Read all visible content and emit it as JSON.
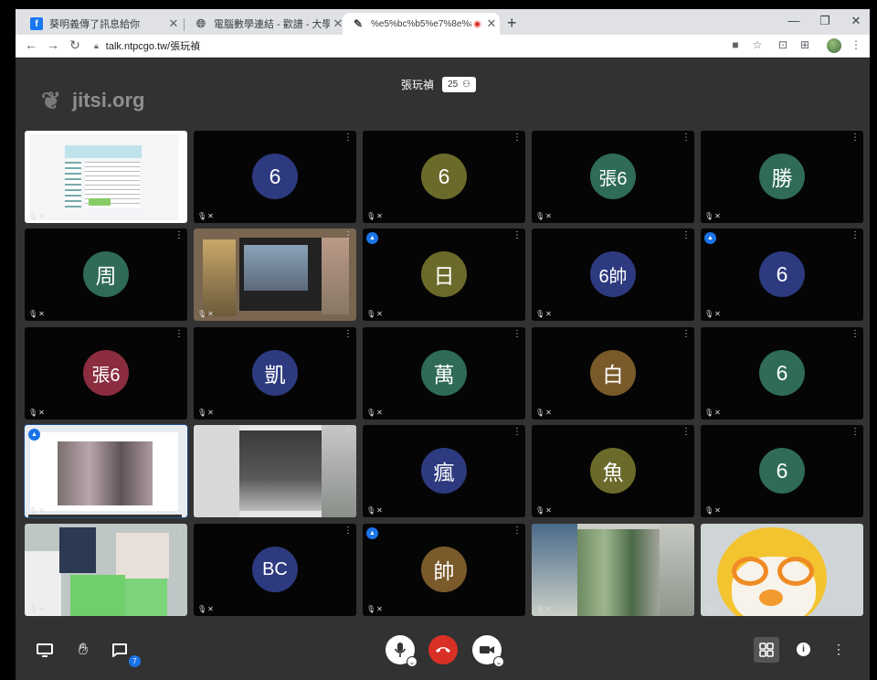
{
  "browser": {
    "tabs": [
      {
        "title": "葵明義傳了訊息給你",
        "favicon": "facebook-icon"
      },
      {
        "title": "電腦數學連結 - 歡譜 - 大學塾",
        "favicon": "globe-icon"
      },
      {
        "title": "%e5%bc%b5%e7%8e%a9",
        "favicon": "jitsi-icon",
        "recording": true
      }
    ],
    "url": "talk.ntpcgo.tw/張玩禎",
    "colors": {
      "tabstrip": "#dfe1e5",
      "record": "#d93025"
    }
  },
  "meeting": {
    "watermark": "jitsi.org",
    "subject": "張玩禎",
    "participant_count": "25",
    "chat_unread": "7",
    "colors": {
      "background": "#323232",
      "hangup": "#d93025",
      "accent": "#1a73e8"
    }
  },
  "tiles": [
    {
      "kind": "screen",
      "avatar": ""
    },
    {
      "kind": "avatar",
      "avatar": "6",
      "color": "#2d3a7f"
    },
    {
      "kind": "avatar",
      "avatar": "6",
      "color": "#6b6a2a"
    },
    {
      "kind": "avatar",
      "avatar": "張6",
      "color": "#2f6b55"
    },
    {
      "kind": "avatar",
      "avatar": "勝",
      "color": "#2f6b55"
    },
    {
      "kind": "avatar",
      "avatar": "周",
      "color": "#2f6b55"
    },
    {
      "kind": "screen2",
      "avatar": ""
    },
    {
      "kind": "avatar",
      "avatar": "日",
      "color": "#6b6a2a",
      "moderator": true
    },
    {
      "kind": "avatar",
      "avatar": "6帥",
      "color": "#2d3a7f"
    },
    {
      "kind": "avatar",
      "avatar": "6",
      "color": "#2d3a7f",
      "moderator": true
    },
    {
      "kind": "avatar",
      "avatar": "張6",
      "color": "#8b2d3f"
    },
    {
      "kind": "avatar",
      "avatar": "凱",
      "color": "#2d3a7f"
    },
    {
      "kind": "avatar",
      "avatar": "萬",
      "color": "#2f6b55"
    },
    {
      "kind": "avatar",
      "avatar": "白",
      "color": "#7a5a2a"
    },
    {
      "kind": "avatar",
      "avatar": "6",
      "color": "#2f6b55"
    },
    {
      "kind": "screen3",
      "avatar": "",
      "moderator": true,
      "active": true
    },
    {
      "kind": "blurcam",
      "avatar": ""
    },
    {
      "kind": "avatar",
      "avatar": "瘋",
      "color": "#2d3a7f"
    },
    {
      "kind": "avatar",
      "avatar": "魚",
      "color": "#6b6a2a"
    },
    {
      "kind": "avatar",
      "avatar": "6",
      "color": "#2f6b55"
    },
    {
      "kind": "classroom",
      "avatar": ""
    },
    {
      "kind": "avatar",
      "avatar": "BC",
      "color": "#2d3a7f"
    },
    {
      "kind": "avatar",
      "avatar": "帥",
      "color": "#7a5a2a",
      "moderator": true
    },
    {
      "kind": "blurcam2",
      "avatar": ""
    },
    {
      "kind": "pororo",
      "avatar": ""
    }
  ]
}
